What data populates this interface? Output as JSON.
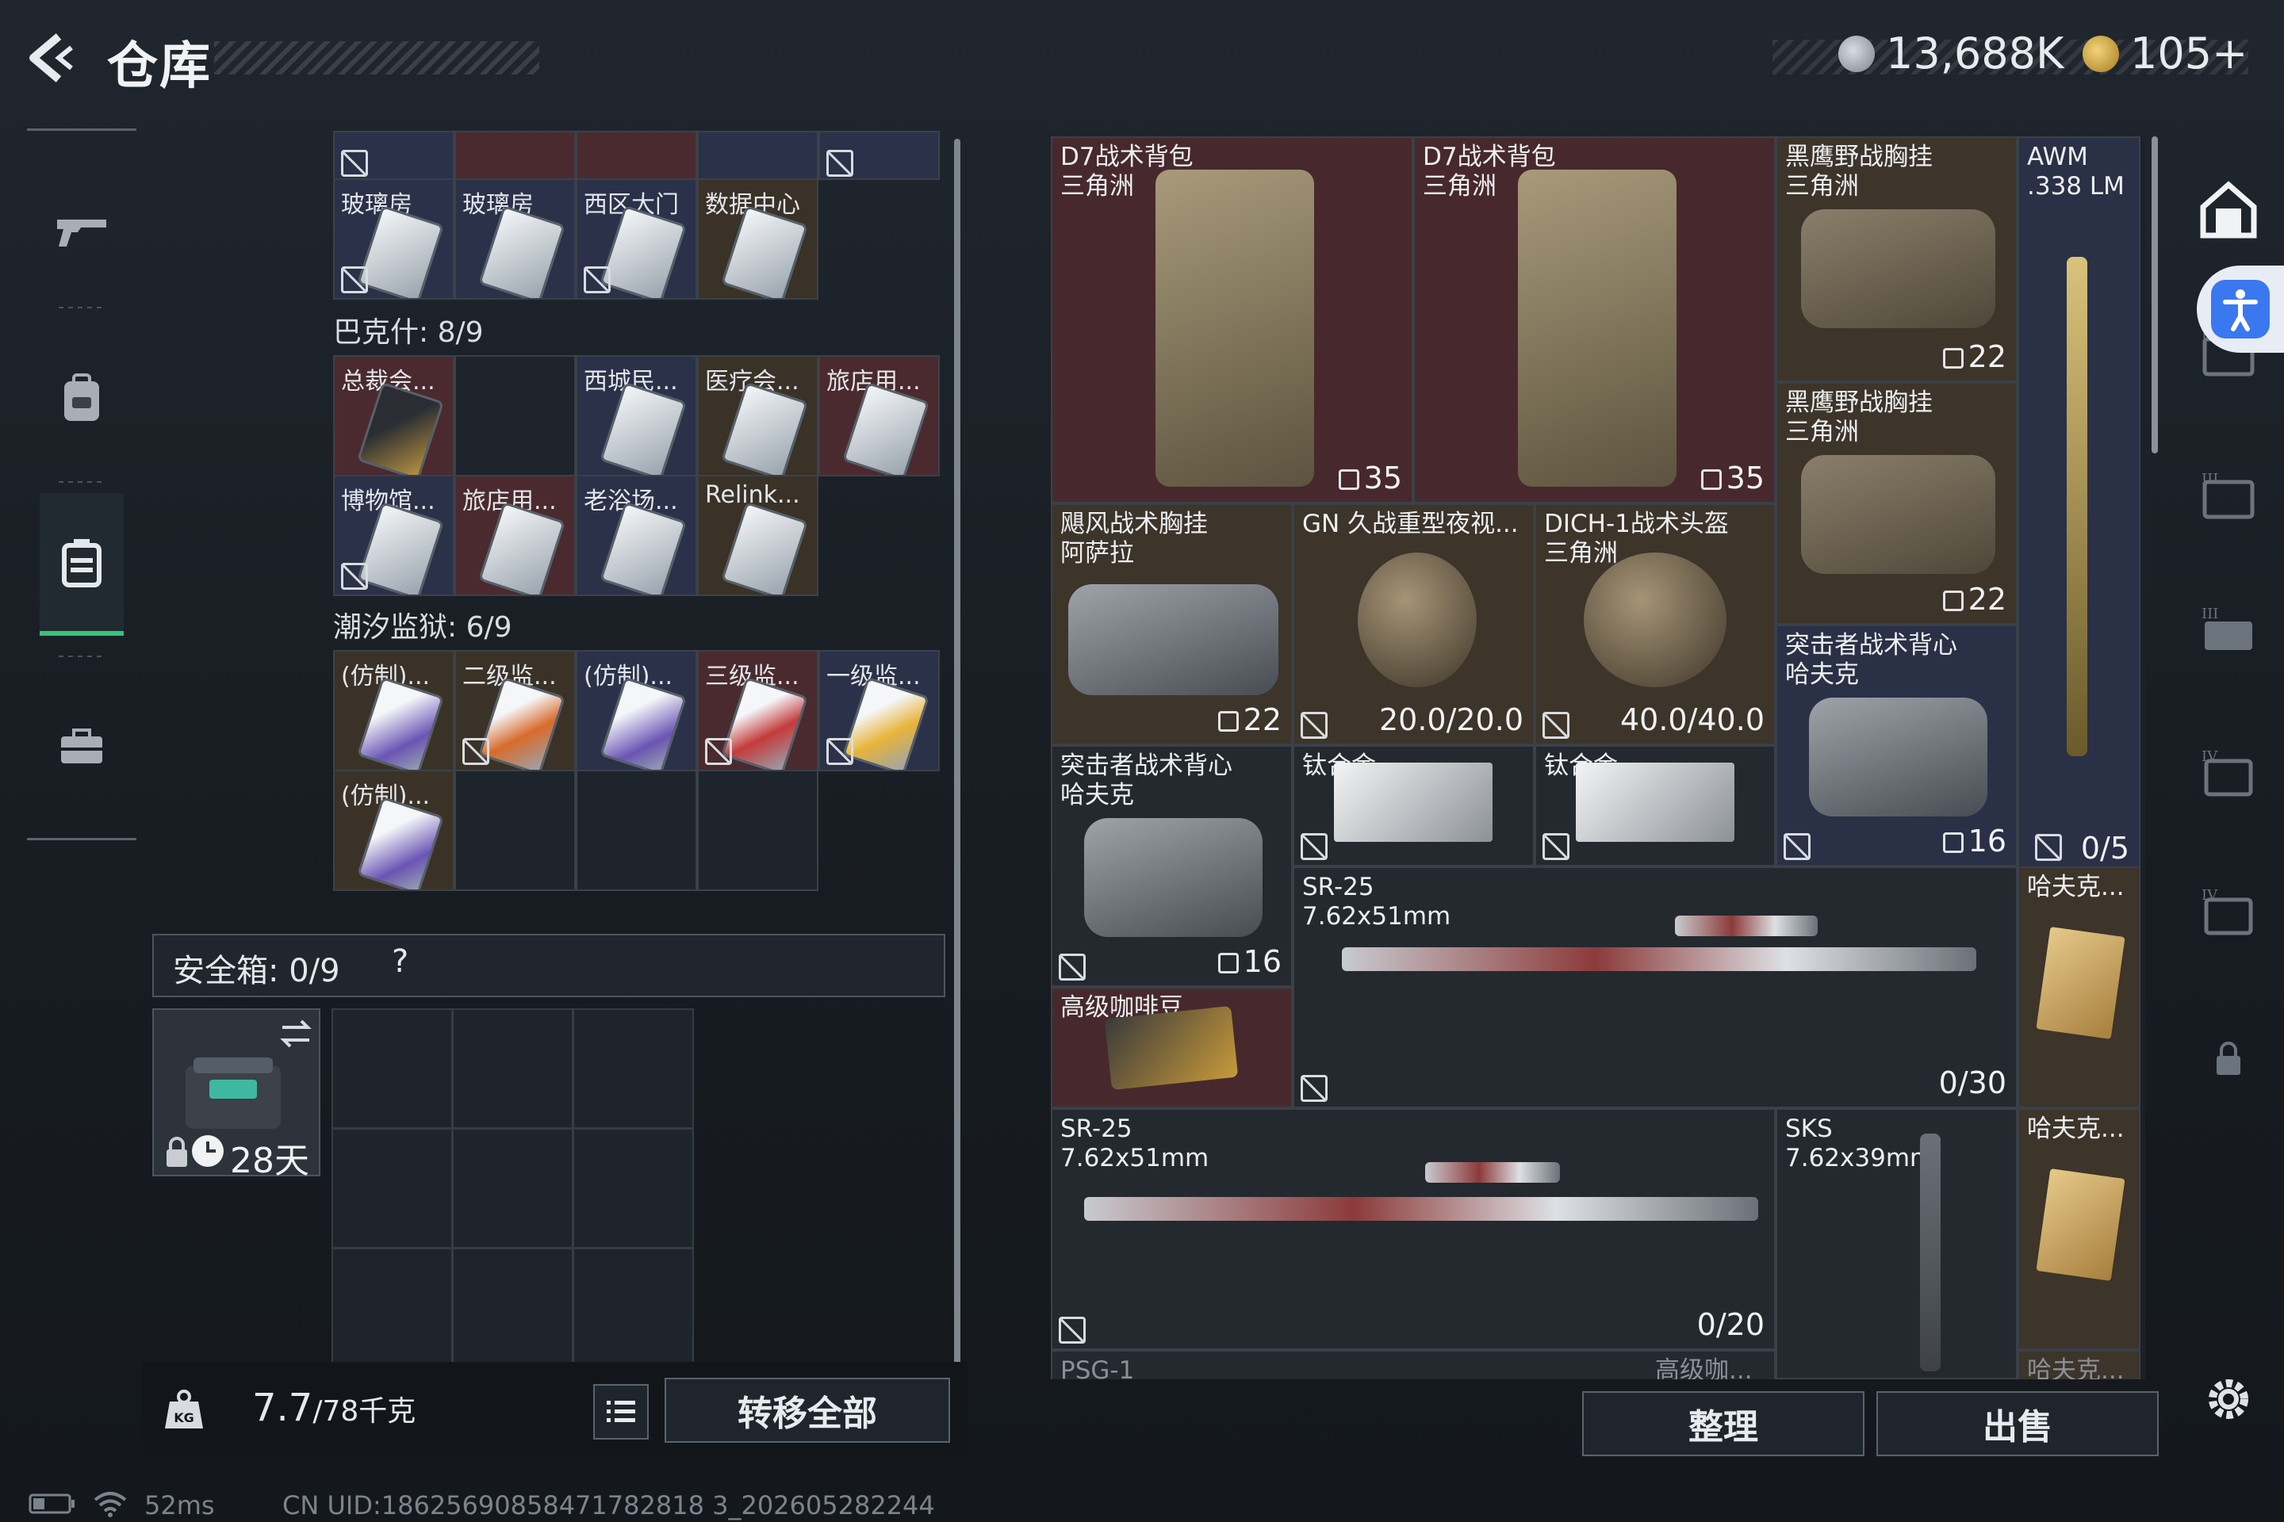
{
  "header": {
    "back_label": "<",
    "title": "仓库"
  },
  "currency": [
    {
      "icon": "silver-coin-icon",
      "value": "13,688K"
    },
    {
      "icon": "gold-coin-icon",
      "value": "105+"
    }
  ],
  "left_nav": [
    {
      "icon": "gun-icon"
    },
    {
      "icon": "backpack-icon"
    },
    {
      "icon": "case-icon",
      "active": true
    },
    {
      "icon": "briefcase-icon"
    }
  ],
  "keycase": {
    "row0": [
      {
        "label": "玻璃房"
      },
      {
        "label": "玻璃房"
      },
      {
        "label": "西区大门"
      },
      {
        "label": "数据中心"
      }
    ],
    "bakeshi": {
      "title": "巴克什: 8/9",
      "row1": [
        {
          "label": "总裁会..."
        },
        {
          "label": ""
        },
        {
          "label": "西城民..."
        },
        {
          "label": "医疗会..."
        },
        {
          "label": "旅店用..."
        }
      ],
      "row2": [
        {
          "label": "博物馆..."
        },
        {
          "label": "旅店用..."
        },
        {
          "label": "老浴场..."
        },
        {
          "label": "Relink..."
        }
      ]
    },
    "chaoxi": {
      "title": "潮汐监狱: 6/9",
      "row1": [
        {
          "label": "(仿制)..."
        },
        {
          "label": "二级监..."
        },
        {
          "label": "(仿制)..."
        },
        {
          "label": "三级监..."
        },
        {
          "label": "一级监..."
        }
      ],
      "row2": [
        {
          "label": "(仿制)..."
        }
      ]
    }
  },
  "safebox": {
    "label": "安全箱: 0/9",
    "help": "?",
    "duration": "28天"
  },
  "weight": {
    "current": "7.7",
    "max": "/78千克"
  },
  "buttons": {
    "transfer_all": "转移全部",
    "organize": "整理",
    "sell": "出售"
  },
  "warehouse": {
    "items": [
      {
        "name": "D7战术背包\n三角洲",
        "value": "35"
      },
      {
        "name": "D7战术背包\n三角洲",
        "value": "35"
      },
      {
        "name": "黑鹰野战胸挂\n三角洲",
        "value": "22"
      },
      {
        "name": "AWM\n.338 LM",
        "value": ""
      },
      {
        "name": "黑鹰野战胸挂\n三角洲",
        "value": "22"
      },
      {
        "name": "飓风战术胸挂\n阿萨拉",
        "value": "22"
      },
      {
        "name": "GN 久战重型夜视...",
        "value": "20.0/20.0"
      },
      {
        "name": "DICH-1战术头盔\n三角洲",
        "value": "40.0/40.0"
      },
      {
        "name": "突击者战术背心\n哈夫克",
        "value": "16"
      },
      {
        "name": "突击者战术背心\n哈夫克",
        "value": "16"
      },
      {
        "name": "钛合金",
        "value": ""
      },
      {
        "name": "钛合金",
        "value": ""
      },
      {
        "name": "SR-25\n7.62x51mm",
        "value": "0/30"
      },
      {
        "name": "哈夫克...",
        "value": ""
      },
      {
        "name": "高级咖啡豆",
        "value": ""
      },
      {
        "name": "SR-25\n7.62x51mm",
        "value": "0/20"
      },
      {
        "name": "SKS\n7.62x39mm",
        "value": ""
      },
      {
        "name": "哈夫克...",
        "value": ""
      },
      {
        "name": "PSG-1",
        "value": ""
      },
      {
        "name": "高级咖...",
        "value": ""
      },
      {
        "name": "哈夫克...",
        "value": ""
      }
    ],
    "awm_ammo": "0/5"
  },
  "right_sidebar": [
    {
      "icon": "vault-icon"
    },
    {
      "icon": "tier3-container-icon"
    },
    {
      "icon": "tier3-container-icon"
    },
    {
      "icon": "tier3-container-icon"
    },
    {
      "icon": "tier4-container-icon"
    },
    {
      "icon": "tier4-container-icon"
    },
    {
      "icon": "lock-icon"
    },
    {
      "icon": "gear-icon"
    }
  ],
  "status": {
    "ping": "52ms",
    "uid": "CN UID:18625690858471782818 3_202605282244"
  }
}
